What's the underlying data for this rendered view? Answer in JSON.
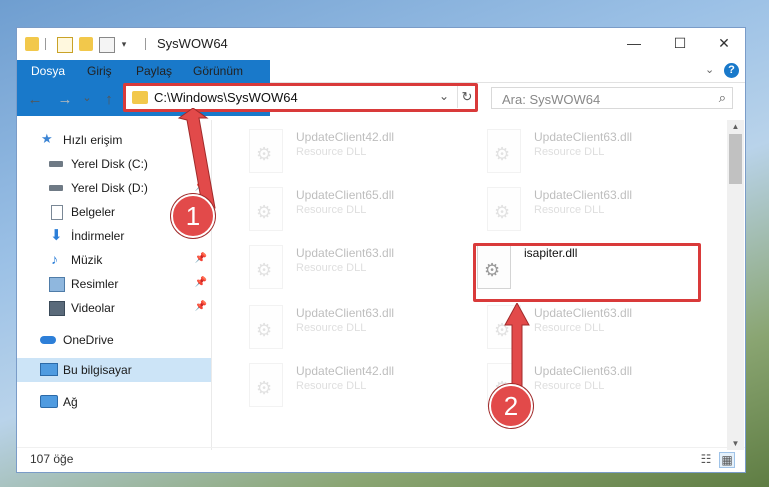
{
  "window": {
    "title": "SysWOW64",
    "controls": {
      "minimize": "—",
      "maximize": "☐",
      "close": "✕"
    }
  },
  "ribbon": {
    "tabs": [
      "Dosya",
      "Giriş",
      "Paylaş",
      "Görünüm"
    ],
    "expand_icon": "chevron-down-icon",
    "help_icon": "?"
  },
  "nav": {
    "back": "←",
    "forward": "→",
    "recent": "⌄",
    "up": "↑",
    "address": "C:\\Windows\\SysWOW64",
    "refresh": "↻",
    "search_placeholder": "Ara: SysWOW64",
    "search_icon": "⌕"
  },
  "sidebar": {
    "items": [
      {
        "label": "Hızlı erişim",
        "icon": "star-icon",
        "pinned": false
      },
      {
        "label": "Yerel Disk (C:)",
        "icon": "drive-icon",
        "pinned": true
      },
      {
        "label": "Yerel Disk (D:)",
        "icon": "drive-icon",
        "pinned": true
      },
      {
        "label": "Belgeler",
        "icon": "document-icon",
        "pinned": true
      },
      {
        "label": "İndirmeler",
        "icon": "download-icon",
        "pinned": true
      },
      {
        "label": "Müzik",
        "icon": "music-icon",
        "pinned": true
      },
      {
        "label": "Resimler",
        "icon": "pictures-icon",
        "pinned": true
      },
      {
        "label": "Videolar",
        "icon": "video-icon",
        "pinned": true
      },
      {
        "label": "OneDrive",
        "icon": "cloud-icon",
        "pinned": false
      },
      {
        "label": "Bu bilgisayar",
        "icon": "computer-icon",
        "pinned": false,
        "selected": true
      },
      {
        "label": "Ağ",
        "icon": "network-icon",
        "pinned": false
      }
    ],
    "pin_glyph": "📌"
  },
  "files": [
    {
      "name": "UpdateClient42.dll",
      "desc": "Resource DLL",
      "faded": true
    },
    {
      "name": "UpdateClient63.dll",
      "desc": "Resource DLL",
      "faded": true
    },
    {
      "name": "UpdateClient65.dll",
      "desc": "Resource DLL",
      "faded": true
    },
    {
      "name": "UpdateClient63.dll",
      "desc": "Resource DLL",
      "faded": true
    },
    {
      "name": "UpdateClient63.dll",
      "desc": "Resource DLL",
      "faded": true
    },
    {
      "name": "isapiter.dll",
      "desc": "",
      "faded": false,
      "highlighted": true
    },
    {
      "name": "UpdateClient63.dll",
      "desc": "Resource DLL",
      "faded": true
    },
    {
      "name": "UpdateClient63.dll",
      "desc": "Resource DLL",
      "faded": true
    },
    {
      "name": "UpdateClient42.dll",
      "desc": "Resource DLL",
      "faded": true
    },
    {
      "name": "UpdateClient63.dll",
      "desc": "Resource DLL",
      "faded": true
    }
  ],
  "status": {
    "item_count": "107 öğe"
  },
  "callouts": {
    "step1": "1",
    "step2": "2",
    "color": "#e24a4a"
  }
}
